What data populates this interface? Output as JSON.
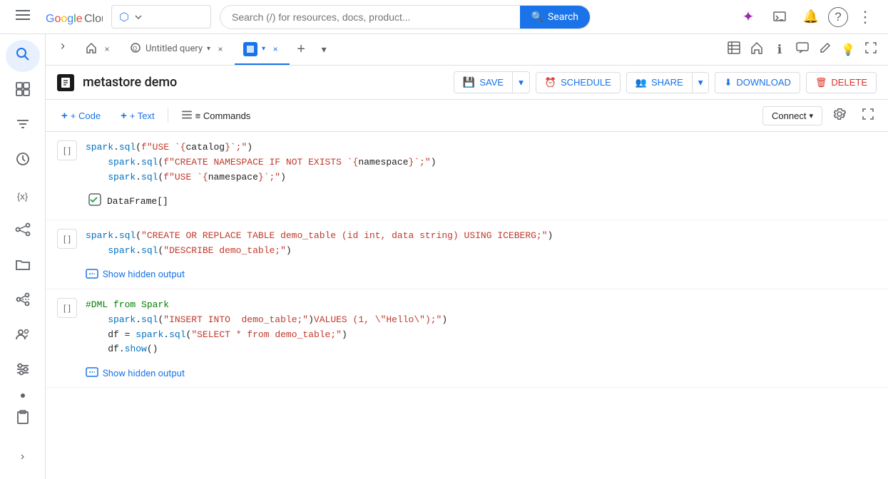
{
  "topNav": {
    "menuIcon": "☰",
    "logoText": "Google Cloud",
    "projectSelector": {
      "icon": "⬡",
      "name": "",
      "chevron": "▾"
    },
    "searchPlaceholder": "Search (/) for resources, docs, product...",
    "searchLabel": "Search",
    "navIcons": [
      {
        "name": "gemini-icon",
        "symbol": "✦",
        "label": "Gemini"
      },
      {
        "name": "terminal-icon",
        "symbol": "⊡",
        "label": "Cloud Shell"
      },
      {
        "name": "bell-icon",
        "symbol": "🔔",
        "label": "Notifications"
      },
      {
        "name": "help-icon",
        "symbol": "?",
        "label": "Help"
      },
      {
        "name": "more-icon",
        "symbol": "⋮",
        "label": "More"
      }
    ]
  },
  "leftSidebar": {
    "icons": [
      {
        "name": "search-sidebar-icon",
        "symbol": "🔍",
        "active": true
      },
      {
        "name": "dashboard-icon",
        "symbol": "⊞",
        "active": false
      },
      {
        "name": "filter-icon",
        "symbol": "≡",
        "active": false
      },
      {
        "name": "history-icon",
        "symbol": "⏱",
        "active": false
      },
      {
        "name": "variable-icon",
        "symbol": "{x}",
        "active": false
      },
      {
        "name": "share-icon",
        "symbol": "⌥",
        "active": false
      },
      {
        "name": "folder-icon",
        "symbol": "📁",
        "active": false
      },
      {
        "name": "pipeline-icon",
        "symbol": "➤",
        "active": false
      },
      {
        "name": "people-icon",
        "symbol": "⚭",
        "active": false
      },
      {
        "name": "settings-icon",
        "symbol": "≈",
        "active": false
      },
      {
        "name": "dot-icon",
        "symbol": "•",
        "active": false
      },
      {
        "name": "clipboard-icon",
        "symbol": "📋",
        "active": false
      }
    ]
  },
  "secondSidebar": {
    "expandIcon": "›",
    "listIcon": "≡"
  },
  "tabs": [
    {
      "id": "home-tab",
      "label": "Home",
      "icon": "🏠",
      "active": false,
      "closeable": true
    },
    {
      "id": "untitled-query-tab",
      "label": "Untitled query",
      "icon": "Q",
      "active": false,
      "closeable": true
    },
    {
      "id": "active-tab",
      "label": "",
      "icon": "□",
      "active": true,
      "closeable": true
    }
  ],
  "tabBar": {
    "addIcon": "+",
    "chevronIcon": "▾",
    "rightIcons": [
      {
        "name": "table-icon",
        "symbol": "≣"
      },
      {
        "name": "home-toolbar-icon",
        "symbol": "🏠"
      },
      {
        "name": "info-icon",
        "symbol": "ℹ"
      },
      {
        "name": "chat-icon",
        "symbol": "💬"
      },
      {
        "name": "edit-toolbar-icon",
        "symbol": "✏"
      },
      {
        "name": "bulb-icon",
        "symbol": "💡"
      },
      {
        "name": "fullscreen-icon",
        "symbol": "⛶"
      }
    ]
  },
  "notebookHeader": {
    "title": "metastore demo",
    "buttons": [
      {
        "name": "save-button",
        "label": "SAVE",
        "icon": "💾",
        "hasDropdown": true
      },
      {
        "name": "schedule-button",
        "label": "SCHEDULE",
        "icon": "⏰",
        "hasDropdown": false
      },
      {
        "name": "share-button",
        "label": "SHARE",
        "icon": "👥",
        "hasDropdown": true
      },
      {
        "name": "download-button",
        "label": "DOWNLOAD",
        "icon": "⬇",
        "hasDropdown": false
      },
      {
        "name": "delete-button",
        "label": "DELETE",
        "icon": "🗑",
        "hasDropdown": false
      }
    ]
  },
  "toolbar": {
    "addCodeLabel": "+ Code",
    "addTextLabel": "+ Text",
    "commandsLabel": "≡ Commands",
    "connectLabel": "Connect",
    "chevron": "▾",
    "gearIcon": "⚙",
    "expandIcon": "⛶"
  },
  "cells": [
    {
      "id": "cell-1",
      "type": "code",
      "runLabel": "[ ]",
      "lines": [
        "spark.sql(f\"USE `{catalog}`;\")\\n    spark.sql(f\"CREATE NAMESPACE IF NOT EXISTS `{namespace}`;\")\\n    spark.sql(f\"USE `{namespace}`;\")"
      ],
      "output": "DataFrame[]",
      "showOutput": false
    },
    {
      "id": "cell-2",
      "type": "code",
      "runLabel": "[ ]",
      "lines": [
        "spark.sql(\"CREATE OR REPLACE TABLE demo_table (id int, data string) USING ICEBERG;\")\\n    spark.sql(\"DESCRIBE demo_table;\")"
      ],
      "output": "",
      "showOutput": true,
      "showHiddenLabel": "Show hidden output"
    },
    {
      "id": "cell-3",
      "type": "code",
      "runLabel": "[ ]",
      "lines": [
        "#DML from Spark\\n    spark.sql(\"INSERT INTO demo_table;\")VALUES (1, \\\"Hello\\\");\"\\n    df = spark.sql(\"SELECT * from demo_table;\")\\n    df.show()"
      ],
      "output": "",
      "showOutput": true,
      "showHiddenLabel": "Show hidden output"
    }
  ]
}
